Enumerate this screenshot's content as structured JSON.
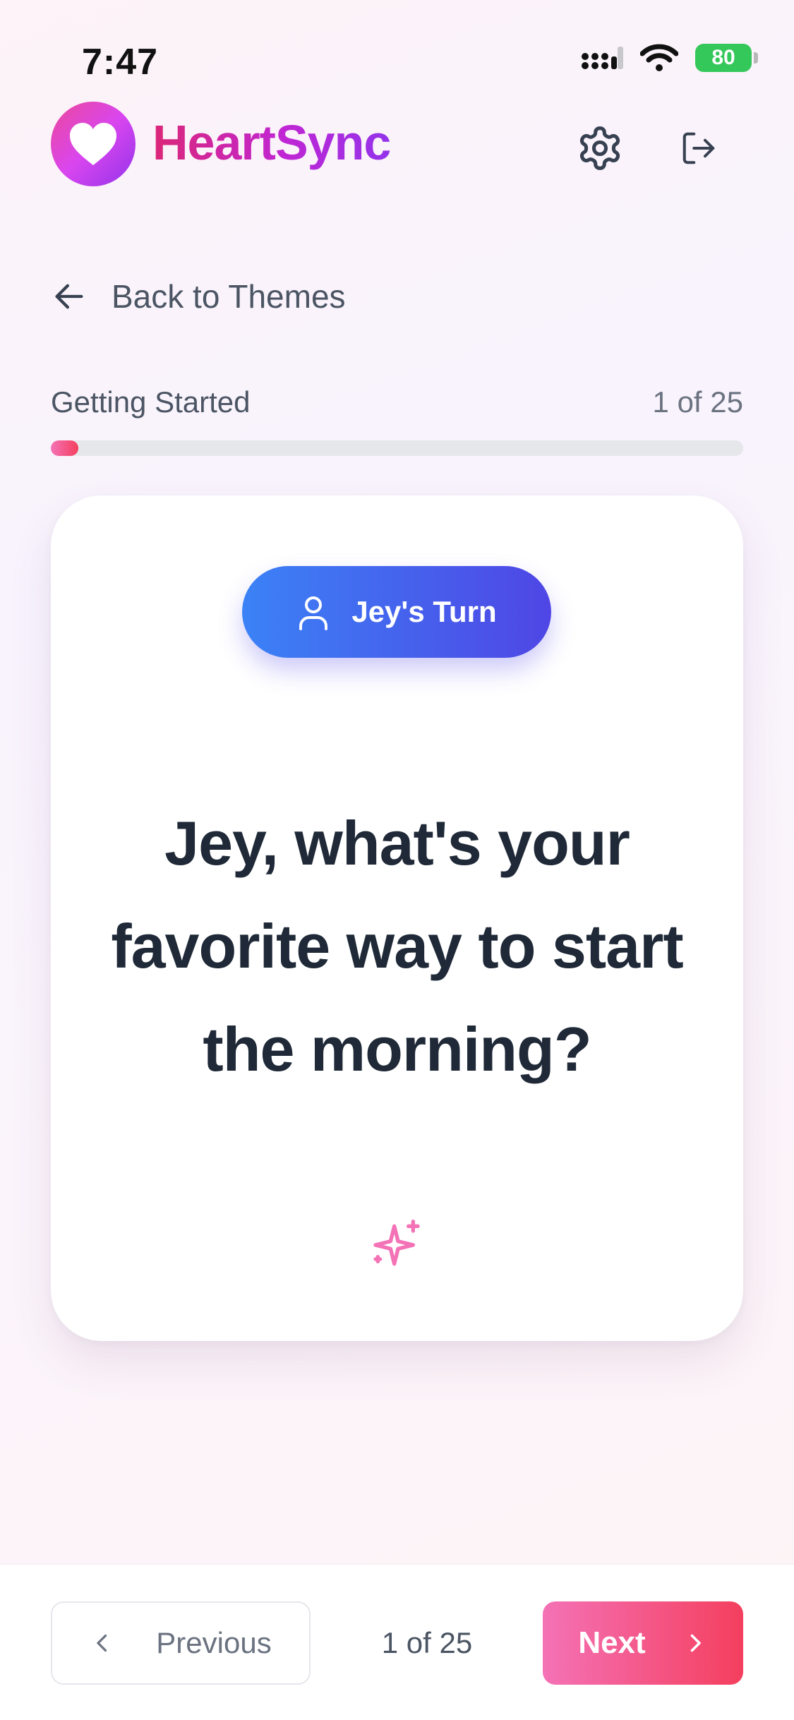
{
  "status_bar": {
    "time": "7:47",
    "battery": "80",
    "icons": [
      "signal-icon",
      "wifi-icon",
      "battery-icon"
    ]
  },
  "header": {
    "app_title": "HeartSync",
    "logo_icon": "heart-icon",
    "settings_icon": "gear-icon",
    "logout_icon": "logout-icon"
  },
  "nav": {
    "back_label": "Back to Themes",
    "back_icon": "arrow-left-icon"
  },
  "progress": {
    "theme_name": "Getting Started",
    "count_label": "1 of 25",
    "current": 1,
    "total": 25
  },
  "card": {
    "turn_label": "Jey's Turn",
    "turn_icon": "user-icon",
    "question": "Jey, what's your favorite way to start the morning?",
    "decor_icon": "sparkles-icon"
  },
  "footer": {
    "previous_label": "Previous",
    "page_indicator": "1 of 25",
    "next_label": "Next"
  },
  "colors": {
    "brand_pink": "#ec4899",
    "brand_purple": "#9333ea",
    "accent_blue": "#3b82f6",
    "accent_indigo": "#4f46e5",
    "next_start": "#f472b6",
    "next_end": "#f43f5e"
  }
}
